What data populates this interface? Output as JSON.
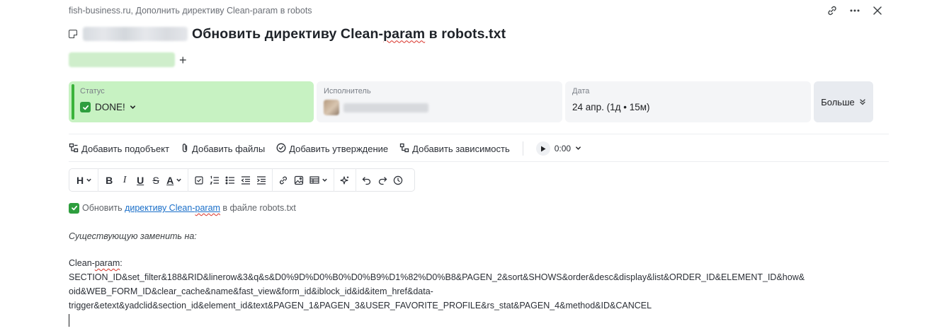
{
  "breadcrumb": "fish-business.ru, Дополнить директиву Clean-param в robots",
  "title": {
    "prefix": "Обновить директиву Clean-",
    "squiggle_word": "param",
    "suffix": " в robots.txt"
  },
  "icons": {
    "link": "link-icon",
    "more": "more-horizontal-icon",
    "close": "close-icon",
    "task": "task-icon",
    "add_tag": "plus-icon"
  },
  "fields": {
    "status": {
      "label": "Статус",
      "value": "DONE!"
    },
    "assignee": {
      "label": "Исполнитель"
    },
    "date": {
      "label": "Дата",
      "value": "24 апр. (1д • 15м)"
    },
    "more_label": "Больше"
  },
  "actions": {
    "add_subtask": "Добавить подобъект",
    "add_files": "Добавить файлы",
    "add_approval": "Добавить утверждение",
    "add_dependency": "Добавить зависимость",
    "timer": "0:00"
  },
  "toolbar": {
    "heading": "H",
    "bold": "B",
    "italic": "I",
    "underline": "U",
    "strike": "S",
    "color": "A"
  },
  "content": {
    "check_prefix": "Обновить ",
    "check_link_a": "директиву Clean-",
    "check_link_squiggle": "param",
    "check_suffix": " в файле robots.txt",
    "replace_label": "Существующую заменить на:",
    "clean_label_a": "Clean-",
    "clean_label_squiggle": "param",
    "clean_label_b": ":",
    "params_line1": "SECTION_ID&set_filter&188&RID&linerow&3&q&s&D0%9D%D0%B0%D0%B9%D1%82%D0%B8&PAGEN_2&sort&SHOWS&order&desc&display&list&ORDER_ID&ELEMENT_ID&how&",
    "params_line2": "oid&WEB_FORM_ID&clear_cache&name&fast_view&form_id&iblock_id&id&item_href&data-",
    "params_line3": "trigger&etext&yadclid&section_id&element_id&text&PAGEN_1&PAGEN_3&USER_FAVORITE_PROFILE&rs_stat&PAGEN_4&method&ID&CANCEL"
  },
  "colors": {
    "status_bg": "#c7f2c2",
    "status_accent": "#3bb33b",
    "link": "#1a6fc9",
    "field_bg": "#f4f5f7"
  }
}
